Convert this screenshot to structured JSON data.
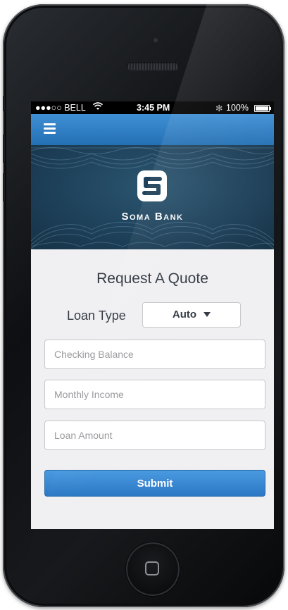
{
  "status_bar": {
    "carrier": "●●●○○ BELL",
    "time": "3:45 PM",
    "bluetooth": "✻",
    "battery": "100%"
  },
  "nav": {
    "menu_icon": "hamburger-menu-icon"
  },
  "banner": {
    "logo_text": "Soma Bank",
    "logo_icon": "soma-s-logo-icon"
  },
  "form": {
    "title": "Request A Quote",
    "loan_type_label": "Loan Type",
    "loan_type_value": "Auto",
    "checking_balance_placeholder": "Checking Balance",
    "monthly_income_placeholder": "Monthly Income",
    "loan_amount_placeholder": "Loan Amount",
    "submit_label": "Submit"
  },
  "colors": {
    "nav_blue": "#2f7fc6",
    "banner_navy": "#1b3c54",
    "submit_blue": "#3a88d2",
    "phone_body": "#111316"
  }
}
